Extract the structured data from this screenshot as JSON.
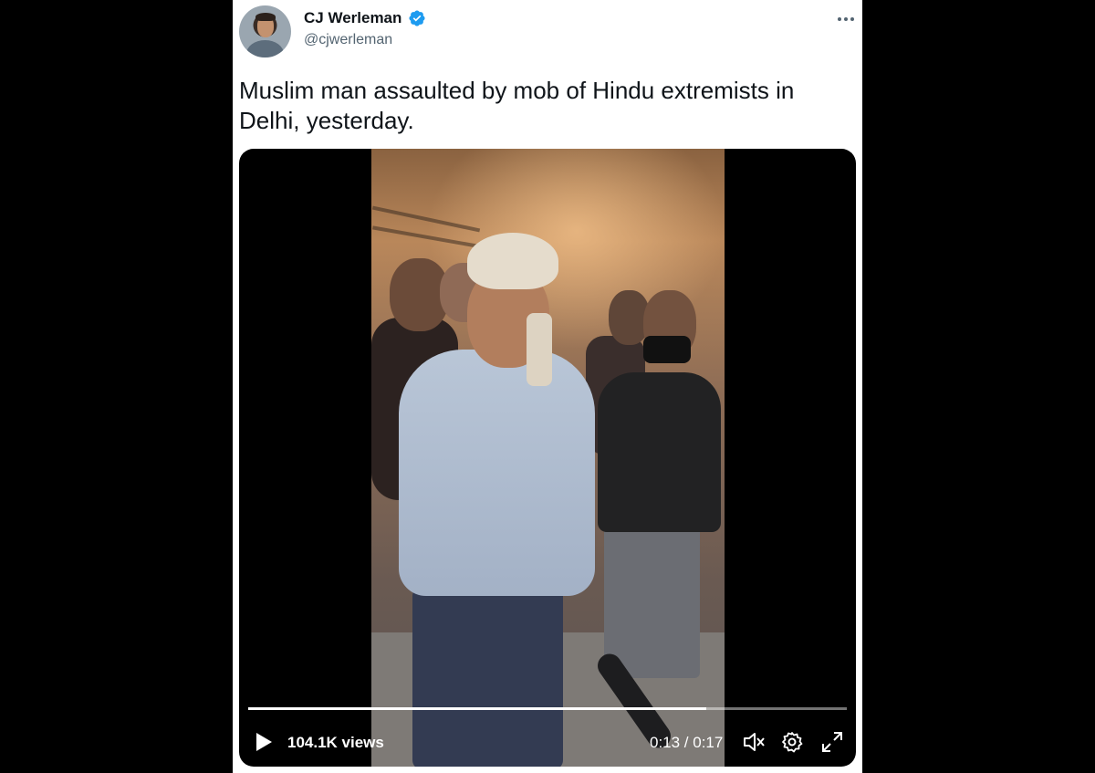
{
  "tweet": {
    "display_name": "CJ Werleman",
    "handle": "@cjwerleman",
    "verified": true,
    "text": "Muslim man assaulted by mob of Hindu extremists in Delhi, yesterday."
  },
  "video": {
    "views": "104.1K views",
    "time": "0:13 / 0:17",
    "progress_fraction": 0.765,
    "controls": [
      "play-icon",
      "mute-icon",
      "settings-icon",
      "fullscreen-icon"
    ]
  },
  "colors": {
    "verified_blue": "#1d9bf0",
    "text_primary": "#0f1419",
    "text_secondary": "#536471",
    "background": "#000000",
    "card": "#ffffff"
  }
}
